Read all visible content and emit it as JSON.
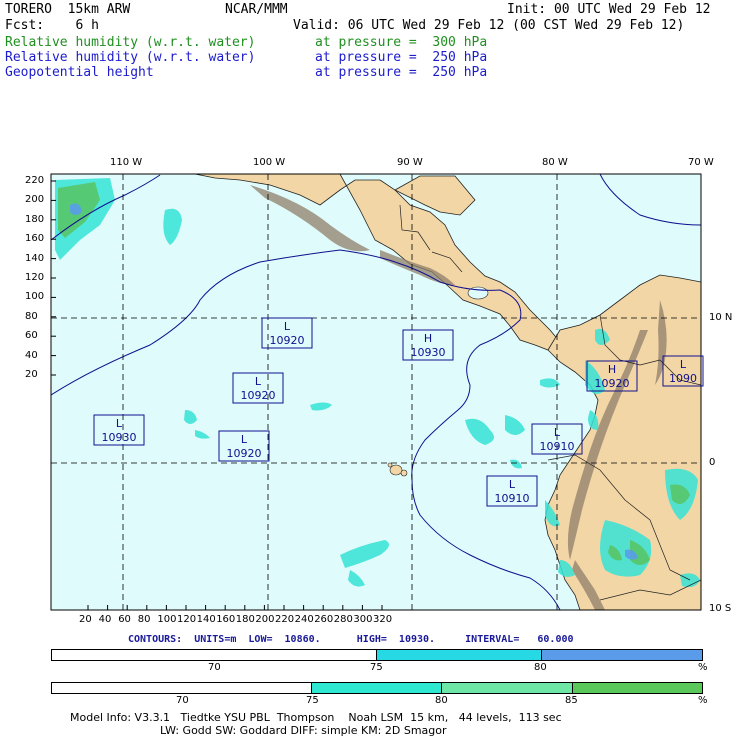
{
  "header": {
    "model": "TORERO  15km ARW",
    "org": "NCAR/MMM",
    "init": "Init: 00 UTC Wed 29 Feb 12",
    "fcst": "Fcst:    6 h",
    "valid": "Valid: 06 UTC Wed 29 Feb 12 (00 CST Wed 29 Feb 12)",
    "fields": [
      {
        "name": "Relative humidity (w.r.t. water)",
        "level": "at pressure =  300 hPa",
        "color": "#1f8f1f"
      },
      {
        "name": "Relative humidity (w.r.t. water)",
        "level": "at pressure =  250 hPa",
        "color": "#1c1ccc"
      },
      {
        "name": "Geopotential height",
        "level": "at pressure =  250 hPa",
        "color": "#1c1ccc"
      }
    ]
  },
  "map": {
    "lon_labels": [
      "110 W",
      "100 W",
      "90 W",
      "80 W",
      "70 W"
    ],
    "lat_labels": [
      "10 N",
      "0",
      "10 S"
    ],
    "y_ticks": [
      "220",
      "200",
      "180",
      "160",
      "140",
      "120",
      "100",
      "80",
      "60",
      "40",
      "20"
    ],
    "x_ticks": [
      "20",
      "40",
      "60",
      "80",
      "100",
      "120",
      "140",
      "160",
      "180",
      "200",
      "220",
      "240",
      "260",
      "280",
      "300",
      "320"
    ],
    "centers": [
      {
        "type": "L",
        "value": "10920"
      },
      {
        "type": "H",
        "value": "10930"
      },
      {
        "type": "L",
        "value": "10920"
      },
      {
        "type": "L",
        "value": "10930"
      },
      {
        "type": "L",
        "value": "10920"
      },
      {
        "type": "L",
        "value": "10910"
      },
      {
        "type": "H",
        "value": "10920"
      },
      {
        "type": "L",
        "value": "1090"
      },
      {
        "type": "L",
        "value": "10910"
      }
    ],
    "colors": {
      "ocean": "#dffbfb",
      "land": "#f3d6a6",
      "terrain": "#8f7f6a",
      "cyan": "#35e3d6",
      "green": "#58c568",
      "contour": "#10108f"
    }
  },
  "contour_info": "CONTOURS:  UNITS=m  LOW=  10860.      HIGH=  10930.     INTERVAL=   60.000",
  "colorbars": [
    {
      "ticks": [
        "70",
        "75",
        "80"
      ],
      "unit": "%",
      "segments": [
        {
          "color": "#ffffff"
        },
        {
          "color": "#27d8e5"
        },
        {
          "color": "#5a9cea"
        }
      ]
    },
    {
      "ticks": [
        "70",
        "75",
        "80",
        "85"
      ],
      "unit": "%",
      "segments": [
        {
          "color": "#ffffff"
        },
        {
          "color": "#2ee8d2"
        },
        {
          "color": "#6ee6a6"
        },
        {
          "color": "#5bc85b"
        }
      ]
    }
  ],
  "footer": {
    "line1": "Model Info: V3.3.1   Tiedtke YSU PBL  Thompson    Noah LSM  15 km,   44 levels,  113 sec",
    "line2": "LW: Godd SW: Goddard DIFF: simple KM: 2D Smagor"
  }
}
